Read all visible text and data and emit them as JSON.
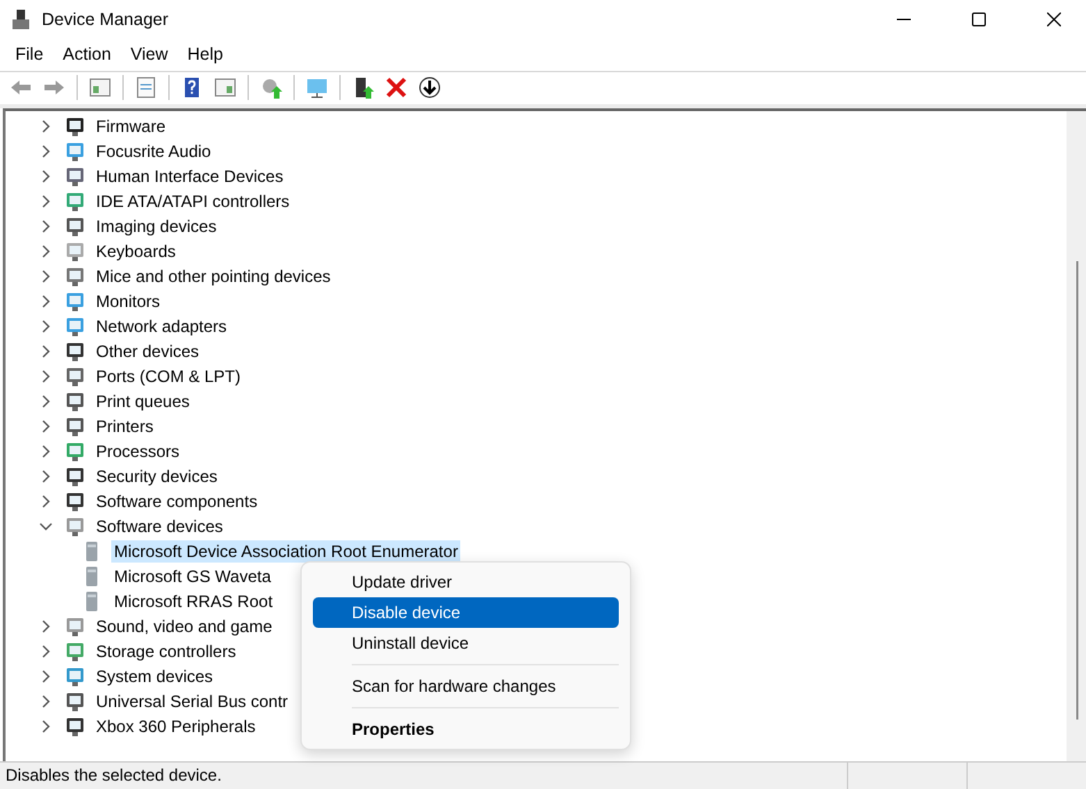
{
  "window": {
    "title": "Device Manager"
  },
  "menu_bar": [
    "File",
    "Action",
    "View",
    "Help"
  ],
  "tree": [
    {
      "label": "Firmware",
      "expanded": false,
      "selected": false
    },
    {
      "label": "Focusrite Audio",
      "expanded": false,
      "selected": false
    },
    {
      "label": "Human Interface Devices",
      "expanded": false,
      "selected": false
    },
    {
      "label": "IDE ATA/ATAPI controllers",
      "expanded": false,
      "selected": false
    },
    {
      "label": "Imaging devices",
      "expanded": false,
      "selected": false
    },
    {
      "label": "Keyboards",
      "expanded": false,
      "selected": false
    },
    {
      "label": "Mice and other pointing devices",
      "expanded": false,
      "selected": false
    },
    {
      "label": "Monitors",
      "expanded": false,
      "selected": false
    },
    {
      "label": "Network adapters",
      "expanded": false,
      "selected": false
    },
    {
      "label": "Other devices",
      "expanded": false,
      "selected": false
    },
    {
      "label": "Ports (COM & LPT)",
      "expanded": false,
      "selected": false
    },
    {
      "label": "Print queues",
      "expanded": false,
      "selected": false
    },
    {
      "label": "Printers",
      "expanded": false,
      "selected": false
    },
    {
      "label": "Processors",
      "expanded": false,
      "selected": false
    },
    {
      "label": "Security devices",
      "expanded": false,
      "selected": false
    },
    {
      "label": "Software components",
      "expanded": false,
      "selected": false
    },
    {
      "label": "Software devices",
      "expanded": true,
      "selected": false,
      "children": [
        {
          "label": "Microsoft Device Association Root Enumerator",
          "selected": true
        },
        {
          "label": "Microsoft GS Waveta",
          "selected": false
        },
        {
          "label": "Microsoft RRAS Root",
          "selected": false
        }
      ]
    },
    {
      "label": "Sound, video and game",
      "expanded": false,
      "selected": false
    },
    {
      "label": "Storage controllers",
      "expanded": false,
      "selected": false
    },
    {
      "label": "System devices",
      "expanded": false,
      "selected": false
    },
    {
      "label": "Universal Serial Bus contr",
      "expanded": false,
      "selected": false
    },
    {
      "label": "Xbox 360 Peripherals",
      "expanded": false,
      "selected": false
    }
  ],
  "context_menu": [
    {
      "kind": "item",
      "label": "Update driver",
      "selected": false,
      "default": false
    },
    {
      "kind": "item",
      "label": "Disable device",
      "selected": true,
      "default": false
    },
    {
      "kind": "item",
      "label": "Uninstall device",
      "selected": false,
      "default": false
    },
    {
      "kind": "separator"
    },
    {
      "kind": "item",
      "label": "Scan for hardware changes",
      "selected": false,
      "default": false
    },
    {
      "kind": "separator"
    },
    {
      "kind": "item",
      "label": "Properties",
      "selected": false,
      "default": true
    }
  ],
  "status_bar": "Disables the selected device."
}
